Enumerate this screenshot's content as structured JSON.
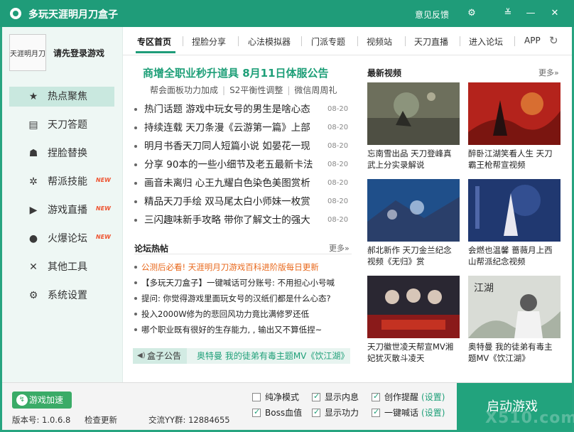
{
  "window": {
    "title": "多玩天涯明月刀盒子",
    "feedback": "意见反馈"
  },
  "user": {
    "login_label": "请先登录游戏",
    "avatar_text": "天涯明月刀"
  },
  "nav": [
    {
      "label": "热点聚焦",
      "icon": "star-icon",
      "active": true,
      "new": false
    },
    {
      "label": "天刀答题",
      "icon": "book-icon",
      "active": false,
      "new": false
    },
    {
      "label": "捏脸替换",
      "icon": "mask-icon",
      "active": false,
      "new": false
    },
    {
      "label": "帮派技能",
      "icon": "fan-icon",
      "active": false,
      "new": true
    },
    {
      "label": "游戏直播",
      "icon": "play-icon",
      "active": false,
      "new": true
    },
    {
      "label": "火爆论坛",
      "icon": "chat-icon",
      "active": false,
      "new": true
    },
    {
      "label": "其他工具",
      "icon": "tools-icon",
      "active": false,
      "new": false
    },
    {
      "label": "系统设置",
      "icon": "gear-icon",
      "active": false,
      "new": false
    }
  ],
  "nav_new_badge": "NEW",
  "tabs": [
    "专区首页",
    "捏脸分享",
    "心法模拟器",
    "门派专题",
    "视频站",
    "天刀直播",
    "进入论坛",
    "APP"
  ],
  "headline": "商增全职业秒升道具 8月11日体服公告",
  "sublinks": [
    "帮会面板功力加成",
    "S2平衡性调整",
    "微信周周礼"
  ],
  "news": [
    {
      "title": "热门话题 游戏中玩女号的男生是啥心态",
      "date": "08-20"
    },
    {
      "title": "持续连载 天刀条漫《云游第一篇》上部",
      "date": "08-20"
    },
    {
      "title": "明月书香天刀同人短篇小说 如晏花一现",
      "date": "08-20"
    },
    {
      "title": "分享 90本的一些小细节及老五最新卡法",
      "date": "08-20"
    },
    {
      "title": "画音未离归 心王九耀白色染色美图赏析",
      "date": "08-20"
    },
    {
      "title": "精品天刀手绘 双马尾太白小师妹一枚赏",
      "date": "08-20"
    },
    {
      "title": "三闪趣味新手攻略 带你了解文士的强大",
      "date": "08-20"
    }
  ],
  "forum": {
    "title": "论坛热帖",
    "more": "更多»",
    "posts": [
      {
        "title": "公测后必看! 天涯明月刀游戏百科进阶版每日更新",
        "hot": true
      },
      {
        "title": "【多玩天刀盒子】一键喊话可分账号: 不用担心小号喊",
        "hot": false
      },
      {
        "title": "提问: 你觉得游戏里面玩女号的汉纸们都是什么心态?",
        "hot": false
      },
      {
        "title": "投入2000W修为的悲回风功力竟比满修罗还低",
        "hot": false
      },
      {
        "title": "哪个职业既有很好的生存能力, , 输出又不算低捏~",
        "hot": false
      }
    ]
  },
  "notice": {
    "label": "盒子公告",
    "text": "奥特曼 我的徒弟有毒主题MV《饮江湖》"
  },
  "videos": {
    "title": "最新视频",
    "more": "更多»",
    "items": [
      {
        "caption": "忘南雪出品 天刀登峰真武上分实录解说"
      },
      {
        "caption": "醉卧江湖笑看人生 天刀霸王枪帮宣视频"
      },
      {
        "caption": "郝北新作 天刀金兰纪念视频《无归》赏"
      },
      {
        "caption": "会燃也温馨 蔷薇月上西山帮派纪念视频"
      },
      {
        "caption": "天刀徽世凌天帮宣MV湘妃犹灭散斗凌天"
      },
      {
        "caption": "奥特曼 我的徒弟有毒主题MV《饮江湖》"
      }
    ]
  },
  "footer": {
    "accelerate": "游戏加速",
    "version": "版本号: 1.0.6.8",
    "check_update": "检查更新",
    "yy_group": "交流YY群: 12884655",
    "start": "启动游戏",
    "watermark": "X510.com",
    "options": [
      {
        "label": "纯净模式",
        "checked": false,
        "setting": ""
      },
      {
        "label": "显示内息",
        "checked": true,
        "setting": ""
      },
      {
        "label": "创作提醒",
        "checked": true,
        "setting": "(设置)"
      },
      {
        "label": "Boss血值",
        "checked": true,
        "setting": ""
      },
      {
        "label": "显示功力",
        "checked": true,
        "setting": ""
      },
      {
        "label": "一键喊话",
        "checked": true,
        "setting": "(设置)"
      }
    ]
  },
  "colors": {
    "brand": "#1f9c79",
    "accent_green": "#1e9f78",
    "hot_orange": "#e8671a",
    "new_badge": "#e53"
  }
}
